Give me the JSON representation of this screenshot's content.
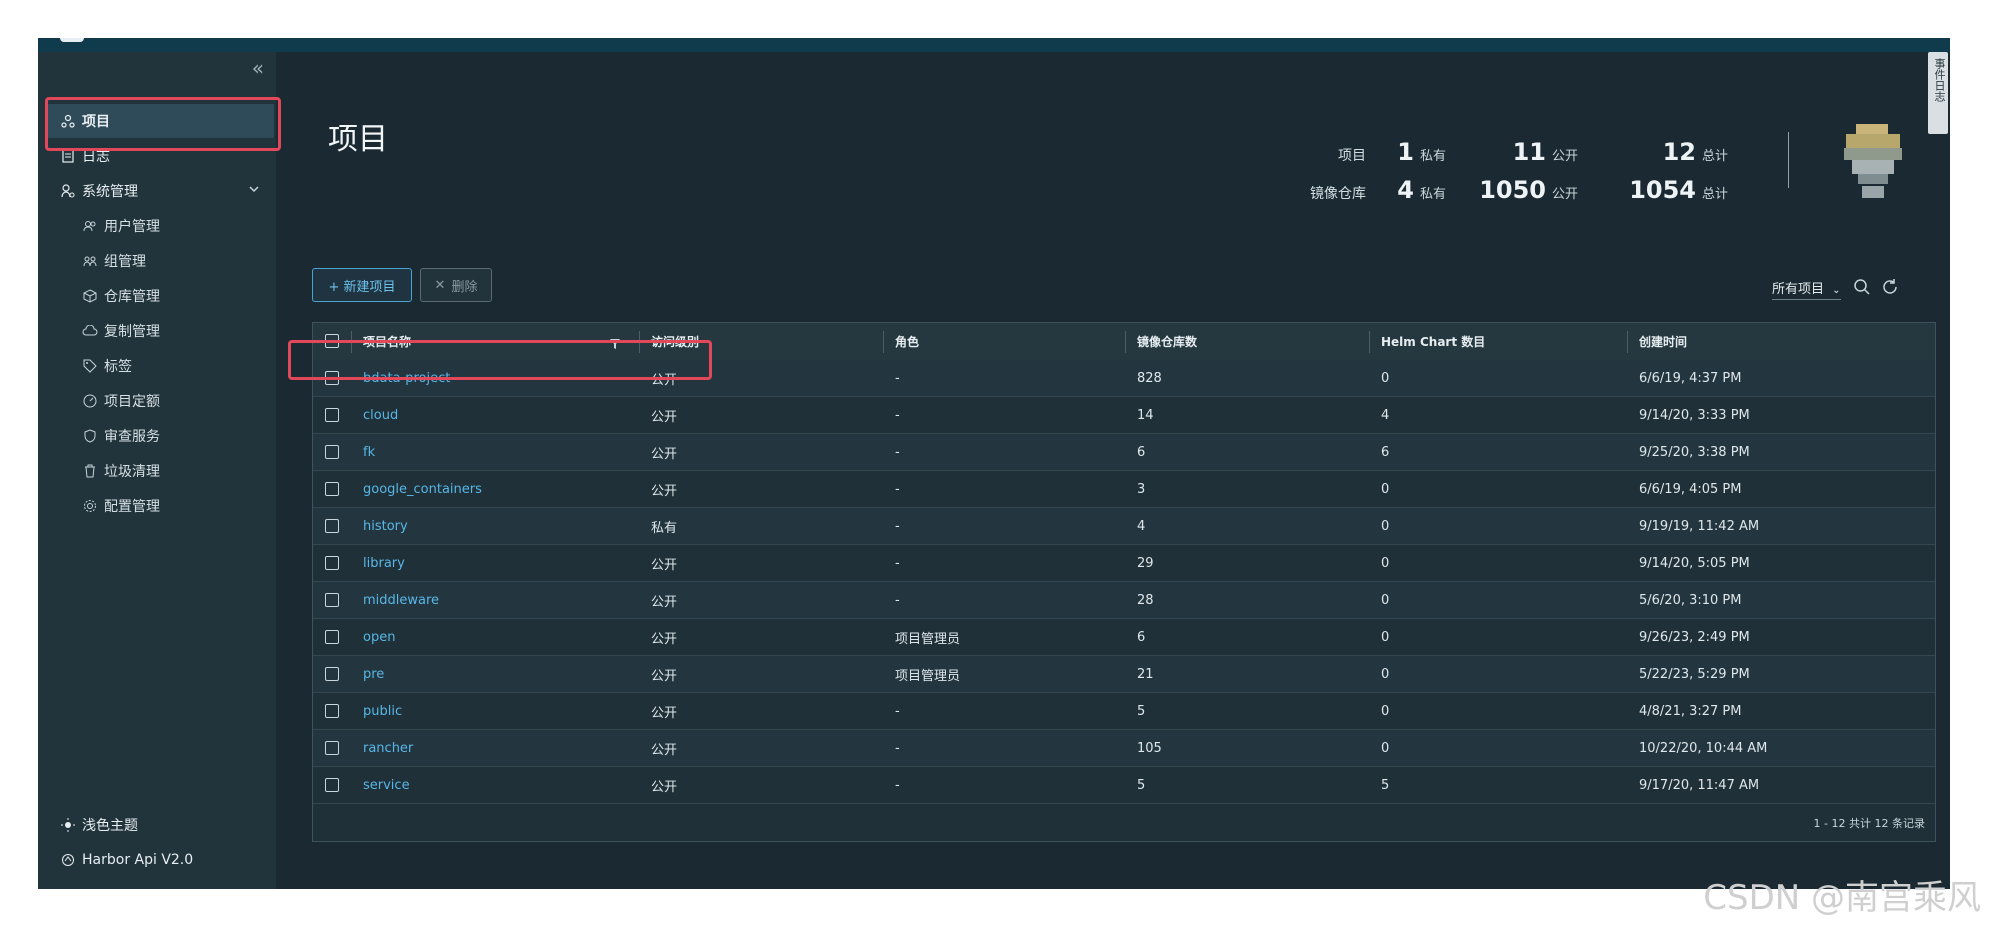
{
  "sidebar": {
    "items": [
      {
        "label": "项目",
        "icon": "project-icon"
      },
      {
        "label": "日志",
        "icon": "log-icon"
      },
      {
        "label": "系统管理",
        "icon": "system-icon"
      }
    ],
    "sub_items": [
      {
        "label": "用户管理",
        "icon": "users-icon"
      },
      {
        "label": "组管理",
        "icon": "group-icon"
      },
      {
        "label": "仓库管理",
        "icon": "cube-icon"
      },
      {
        "label": "复制管理",
        "icon": "cloud-sync-icon"
      },
      {
        "label": "标签",
        "icon": "tag-icon"
      },
      {
        "label": "项目定额",
        "icon": "dashboard-icon"
      },
      {
        "label": "审查服务",
        "icon": "shield-icon"
      },
      {
        "label": "垃圾清理",
        "icon": "trash-icon"
      },
      {
        "label": "配置管理",
        "icon": "gear-icon"
      }
    ],
    "footer": [
      {
        "label": "浅色主题",
        "icon": "sun-icon"
      },
      {
        "label": "Harbor Api V2.0",
        "icon": "api-icon"
      }
    ]
  },
  "header": {
    "title": "项目"
  },
  "stats": {
    "projects_label": "项目",
    "repos_label": "镜像仓库",
    "projects": {
      "private": "1",
      "public": "11",
      "total": "12"
    },
    "repos": {
      "private": "4",
      "public": "1050",
      "total": "1054"
    },
    "private_label": "私有",
    "public_label": "公开",
    "total_label": "总计"
  },
  "toolbar": {
    "new_label": "+ 新建项目",
    "delete_label": "删除",
    "filter_label": "所有项目"
  },
  "table": {
    "columns": [
      "项目名称",
      "访问级别",
      "角色",
      "镜像仓库数",
      "Helm Chart 数目",
      "创建时间"
    ],
    "rows": [
      {
        "name": "bdata-project",
        "access": "公开",
        "role": "-",
        "repos": "828",
        "charts": "0",
        "created": "6/6/19, 4:37 PM"
      },
      {
        "name": "cloud",
        "access": "公开",
        "role": "-",
        "repos": "14",
        "charts": "4",
        "created": "9/14/20, 3:33 PM"
      },
      {
        "name": "fk",
        "access": "公开",
        "role": "-",
        "repos": "6",
        "charts": "6",
        "created": "9/25/20, 3:38 PM"
      },
      {
        "name": "google_containers",
        "access": "公开",
        "role": "-",
        "repos": "3",
        "charts": "0",
        "created": "6/6/19, 4:05 PM"
      },
      {
        "name": "history",
        "access": "私有",
        "role": "-",
        "repos": "4",
        "charts": "0",
        "created": "9/19/19, 11:42 AM"
      },
      {
        "name": "library",
        "access": "公开",
        "role": "-",
        "repos": "29",
        "charts": "0",
        "created": "9/14/20, 5:05 PM"
      },
      {
        "name": "middleware",
        "access": "公开",
        "role": "-",
        "repos": "28",
        "charts": "0",
        "created": "5/6/20, 3:10 PM"
      },
      {
        "name": "open",
        "access": "公开",
        "role": "项目管理员",
        "repos": "6",
        "charts": "0",
        "created": "9/26/23, 2:49 PM"
      },
      {
        "name": "pre",
        "access": "公开",
        "role": "项目管理员",
        "repos": "21",
        "charts": "0",
        "created": "5/22/23, 5:29 PM"
      },
      {
        "name": "public",
        "access": "公开",
        "role": "-",
        "repos": "5",
        "charts": "0",
        "created": "4/8/21, 3:27 PM"
      },
      {
        "name": "rancher",
        "access": "公开",
        "role": "-",
        "repos": "105",
        "charts": "0",
        "created": "10/22/20, 10:44 AM"
      },
      {
        "name": "service",
        "access": "公开",
        "role": "-",
        "repos": "5",
        "charts": "5",
        "created": "9/17/20, 11:47 AM"
      }
    ],
    "pager": "1 - 12 共计 12 条记录"
  },
  "side_tab": {
    "label": "事件日志"
  },
  "watermark": "CSDN @南宫乘风"
}
